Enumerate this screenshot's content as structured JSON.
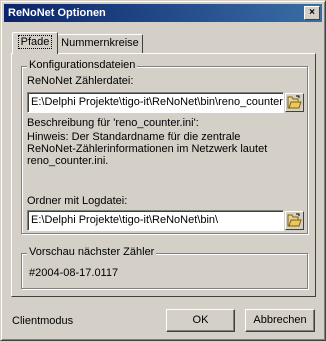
{
  "window": {
    "title": "ReNoNet Optionen",
    "close_glyph": "×"
  },
  "tabs": [
    {
      "label": "Pfade",
      "active": true
    },
    {
      "label": "Nummernkreise",
      "active": false
    }
  ],
  "config_group": {
    "caption": "Konfigurationsdateien",
    "counter_file_label": "ReNoNet Zählerdatei:",
    "counter_file_value": "E:\\Delphi Projekte\\tigo-it\\ReNoNet\\bin\\reno_counter.ini",
    "description_label": "Beschreibung für 'reno_counter.ini':",
    "description_line1": "Hinweis: Der Standardname für die zentrale",
    "description_line2": "ReNoNet-Zählerinformationen im Netzwerk lautet",
    "description_line3": "reno_counter.ini.",
    "log_folder_label": "Ordner mit Logdatei:",
    "log_folder_value": "E:\\Delphi Projekte\\tigo-it\\ReNoNet\\bin\\"
  },
  "preview_group": {
    "caption": "Vorschau nächster Zähler",
    "value": "#2004-08-17.0117"
  },
  "footer": {
    "mode_label": "Clientmodus",
    "ok_label": "OK",
    "cancel_label": "Abbrechen"
  },
  "icons": {
    "browse_counter": "folder-open-icon",
    "browse_log": "folder-open-icon"
  }
}
